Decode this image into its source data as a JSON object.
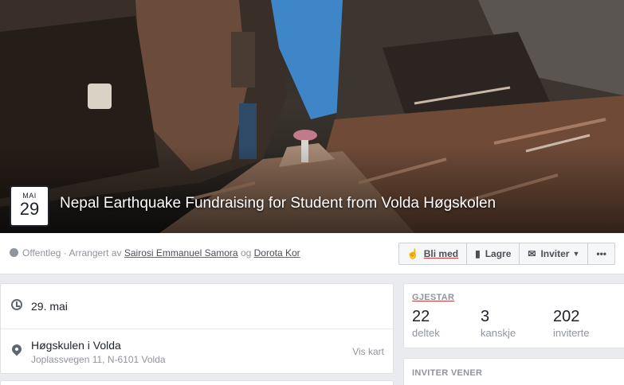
{
  "event": {
    "month": "MAI",
    "day": "29",
    "title": "Nepal Earthquake Fundraising for Student from Volda Høgskolen"
  },
  "meta": {
    "privacy": "Offentleg · Arrangert av",
    "organizer1": "Sairosi Emmanuel Samora",
    "joiner": "og",
    "organizer2": "Dorota Kor"
  },
  "actions": {
    "join": "Bli med",
    "save": "Lagre",
    "invite": "Inviter",
    "more": "•••"
  },
  "details": {
    "date": "29. mai",
    "location_name": "Høgskulen i Volda",
    "location_address": "Joplassvegen 11, N-6101 Volda",
    "map_link": "Vis kart"
  },
  "guests": {
    "heading": "GJESTAR",
    "stats": [
      {
        "count": "22",
        "label": "deltek"
      },
      {
        "count": "3",
        "label": "kanskje"
      },
      {
        "count": "202",
        "label": "inviterte"
      }
    ]
  },
  "invite_friends": {
    "heading": "INVITER VENER"
  },
  "colors": {
    "accent": "#4b4f56",
    "muted": "#90949c",
    "sky": "#3f86c9"
  }
}
